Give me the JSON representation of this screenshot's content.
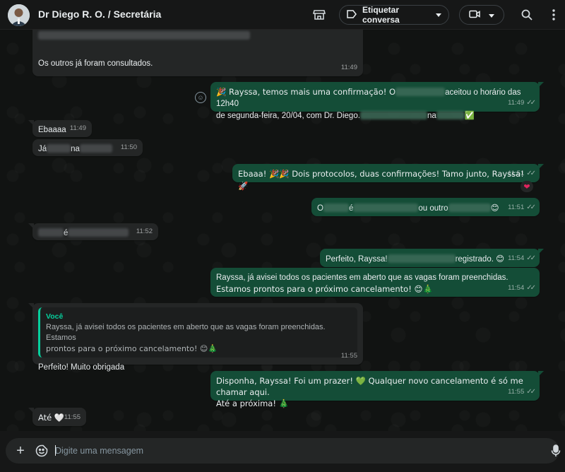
{
  "header": {
    "title": "Dr Diego R. O. / Secretária",
    "tag_label": "Etiquetar conversa",
    "icons": [
      "store-icon",
      "tag-icon",
      "chevron-down-icon",
      "video-icon",
      "search-icon",
      "menu-icon"
    ]
  },
  "messages": [
    {
      "id": "m1",
      "direction": "in",
      "text": "Os outros já foram consultados.",
      "time": "11:49"
    },
    {
      "id": "m2",
      "direction": "out",
      "line1_a": "🎉 Rayssa, temos mais uma confirmação! O",
      "line1_b": "aceitou o horário das 12h40",
      "line2_a": "de segunda-feira, 20/04, com Dr. Diego.",
      "line2_b": "na",
      "check": "✅",
      "time": "11:49"
    },
    {
      "id": "m3",
      "direction": "in",
      "text": "Ebaaaa",
      "time": "11:49"
    },
    {
      "id": "m4",
      "direction": "in",
      "text_a": "Já",
      "text_b": "na",
      "time": "11:50"
    },
    {
      "id": "m5",
      "direction": "out",
      "text": "Ebaaa! 🎉🎉 Dois protocolos, duas confirmações! Tamo junto, Rayssa! 🚀",
      "time": "11:51",
      "reaction": "❤"
    },
    {
      "id": "m6",
      "direction": "out",
      "text_a": "O",
      "text_b": "é",
      "text_c": "ou outro",
      "emoji": "😊",
      "time": "11:51"
    },
    {
      "id": "m7",
      "direction": "in",
      "text_a": "é",
      "time": "11:52"
    },
    {
      "id": "m8",
      "direction": "out",
      "text_a": "Perfeito, Rayssa!",
      "text_b": "registrado.",
      "emoji": "😊",
      "time": "11:54"
    },
    {
      "id": "m9",
      "direction": "out",
      "line1": "Rayssa, já avisei todos os pacientes em aberto que as vagas foram preenchidas.",
      "line2": "Estamos prontos para o próximo cancelamento! 😊🎄",
      "time": "11:54"
    },
    {
      "id": "m10",
      "direction": "in",
      "quote_author": "Você",
      "quote_line1": "Rayssa, já avisei todos os pacientes em aberto que as vagas foram preenchidas. Estamos",
      "quote_line2": "prontos para o próximo cancelamento! 😊🎄",
      "text": "Perfeito! Muito obrigada",
      "time": "11:55"
    },
    {
      "id": "m11",
      "direction": "out",
      "line1": "Disponha, Rayssa! Foi um prazer! 💚 Qualquer novo cancelamento é só me chamar aqui.",
      "line2": "Até a próxima! 🎄",
      "time": "11:55"
    },
    {
      "id": "m12",
      "direction": "in",
      "text": "Até 🤍",
      "time": "11:55"
    }
  ],
  "composer": {
    "placeholder": "Digite uma mensagem",
    "value": ""
  },
  "colors": {
    "background": "#161717",
    "incoming_bubble": "#242626",
    "outgoing_bubble": "#144d37",
    "accent": "#06cf9c"
  }
}
